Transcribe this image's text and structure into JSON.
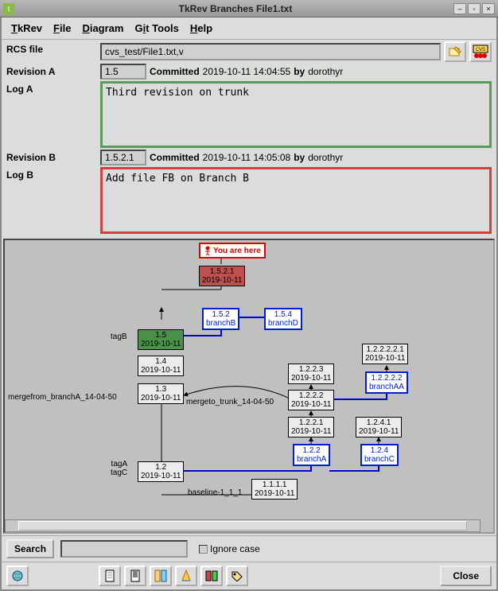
{
  "window": {
    "title": "TkRev Branches File1.txt"
  },
  "menu": {
    "app": "TkRev",
    "file": "File",
    "diagram": "Diagram",
    "git": "Git Tools",
    "help": "Help"
  },
  "rcs": {
    "label": "RCS file",
    "value": "cvs_test/File1.txt,v"
  },
  "revA": {
    "label": "Revision A",
    "value": "1.5",
    "committed_lbl": "Committed",
    "date": "2019-10-11 14:04:55",
    "by_lbl": "by",
    "user": "dorothyr"
  },
  "logA": {
    "label": "Log A",
    "text": "Third revision on trunk"
  },
  "revB": {
    "label": "Revision B",
    "value": "1.5.2.1",
    "committed_lbl": "Committed",
    "date": "2019-10-11 14:05:08",
    "by_lbl": "by",
    "user": "dorothyr"
  },
  "logB": {
    "label": "Log B",
    "text": "Add file FB on Branch B"
  },
  "search": {
    "label": "Search",
    "ignore": "Ignore case",
    "value": ""
  },
  "close": "Close",
  "youare": "You are here",
  "nodes": {
    "n1521": "1.5.2.1\n2019-10-11",
    "n152": "1.5.2\nbranchB",
    "n154": "1.5.4\nbranchD",
    "n15": "1.5\n2019-10-11",
    "n14": "1.4\n2019-10-11",
    "n13": "1.3\n2019-10-11",
    "n12": "1.2\n2019-10-11",
    "n1111": "1.1.1.1\n2019-10-11",
    "n1223": "1.2.2.3\n2019-10-11",
    "n1222": "1.2.2.2\n2019-10-11",
    "n1221": "1.2.2.1\n2019-10-11",
    "n122": "1.2.2\nbranchA",
    "n124": "1.2.4\nbranchC",
    "n1241": "1.2.4.1\n2019-10-11",
    "n122221": "1.2.2.2.2.1\n2019-10-11",
    "n12222": "1.2.2.2.2\nbranchAA"
  },
  "tags": {
    "tagB": "tagB",
    "tagAC": "tagA\ntagC",
    "mergefrom": "mergefrom_branchA_14-04-50",
    "mergeto": "mergeto_trunk_14-04-50",
    "baseline": "baseline-1_1_1"
  }
}
